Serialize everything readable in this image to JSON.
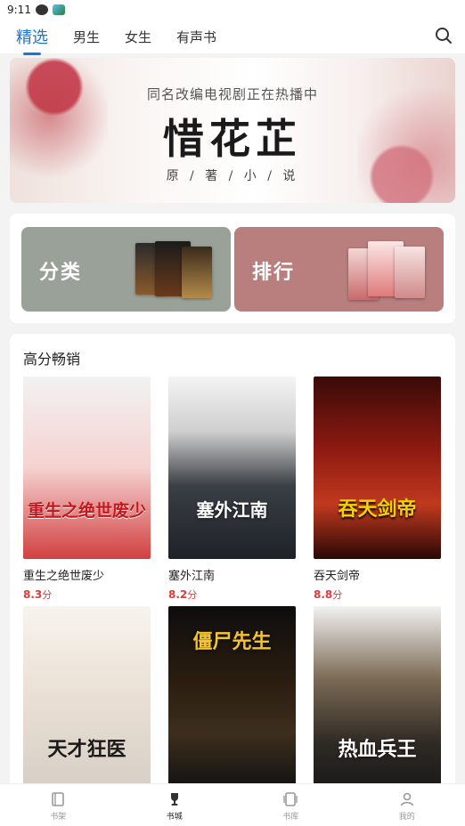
{
  "status": {
    "time": "9:11"
  },
  "topnav": {
    "tabs": [
      {
        "label": "精选",
        "active": true
      },
      {
        "label": "男生",
        "active": false
      },
      {
        "label": "女生",
        "active": false
      },
      {
        "label": "有声书",
        "active": false
      }
    ],
    "search_icon": "search-icon",
    "accent_color": "#1976d2"
  },
  "banner": {
    "subtitle": "同名改编电视剧正在热播中",
    "title": "惜花芷",
    "tagline": "原 / 著 / 小 / 说"
  },
  "entries": {
    "category_label": "分类",
    "category_color": "#9aa198",
    "ranking_label": "排行",
    "ranking_color": "#b87f7e"
  },
  "bestsellers": {
    "title": "高分畅销",
    "score_color": "#e53935",
    "books": [
      {
        "title": "重生之绝世废少",
        "score": "8.3",
        "score_unit": "分",
        "cover_text": "重生之绝世废少"
      },
      {
        "title": "塞外江南",
        "score": "8.2",
        "score_unit": "分",
        "cover_text": "塞外江南"
      },
      {
        "title": "吞天剑帝",
        "score": "8.8",
        "score_unit": "分",
        "cover_text": "吞天剑帝"
      },
      {
        "title": "",
        "score": "",
        "score_unit": "",
        "cover_text": "天才狂医"
      },
      {
        "title": "",
        "score": "",
        "score_unit": "",
        "cover_text": "僵尸先生"
      },
      {
        "title": "",
        "score": "",
        "score_unit": "",
        "cover_text": "热血兵王"
      }
    ]
  },
  "bottomnav": {
    "items": [
      {
        "label": "书架",
        "icon": "bookshelf-icon",
        "active": false
      },
      {
        "label": "书城",
        "icon": "trophy-icon",
        "active": true
      },
      {
        "label": "书库",
        "icon": "library-icon",
        "active": false
      },
      {
        "label": "我的",
        "icon": "profile-icon",
        "active": false
      }
    ]
  }
}
